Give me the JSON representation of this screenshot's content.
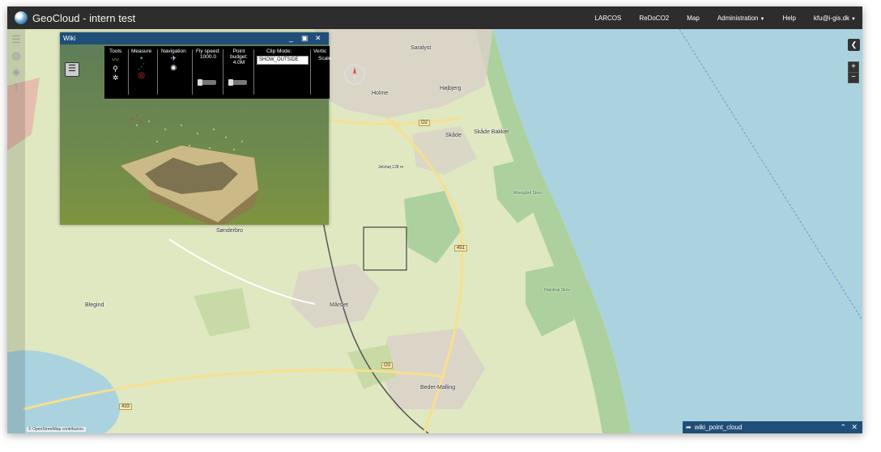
{
  "navbar": {
    "app_title": "GeoCloud - intern test",
    "items": [
      {
        "label": "LARCOS"
      },
      {
        "label": "ReDoCO2"
      },
      {
        "label": "Map"
      },
      {
        "label": "Administration"
      },
      {
        "label": "Help"
      },
      {
        "label": "kfu@i-gis.dk"
      }
    ]
  },
  "wiki_window": {
    "title": "Wiki",
    "toolbar": {
      "tools": "Tools",
      "measure": "Measure",
      "navigation": "Navigation",
      "fly_speed_label": "Fly speed:",
      "fly_speed_value": "1000.0",
      "point_budget_label": "Point budget:",
      "point_budget_value": "4.0M",
      "clip_mode_label": "Clip Mode:",
      "clip_mode_value": "SHOW_OUTSIDE",
      "vertical_label": "Vertic",
      "scale_label": "Scale"
    }
  },
  "map_labels": {
    "saralyst": "Saralyst",
    "hojbjerg": "Højbjerg",
    "holme": "Holme",
    "skade": "Skåde",
    "skade_bakker": "Skåde Bakker",
    "jelshoj": "Jelshøj 128 m",
    "sonderbro": "Sønderbro",
    "blegind": "Blegind",
    "marslet": "Mårslet",
    "beder_malling": "Beder-Malling",
    "moesgard": "Moesgård Skov",
    "fljstrup": "Fløjstrup Skov"
  },
  "road_shields": {
    "o2": "O2",
    "r451": "451",
    "o3": "O3",
    "r433": "433"
  },
  "bottom_panel": {
    "title": "wiki_point_cloud"
  },
  "attribution": {
    "text": "© OpenStreetMap contributors."
  },
  "colors": {
    "navbar_bg": "#2d2d2d",
    "panel_header": "#1f4f78",
    "sea": "#aad3df",
    "land": "#dfe8c1",
    "forest": "#add19e"
  }
}
